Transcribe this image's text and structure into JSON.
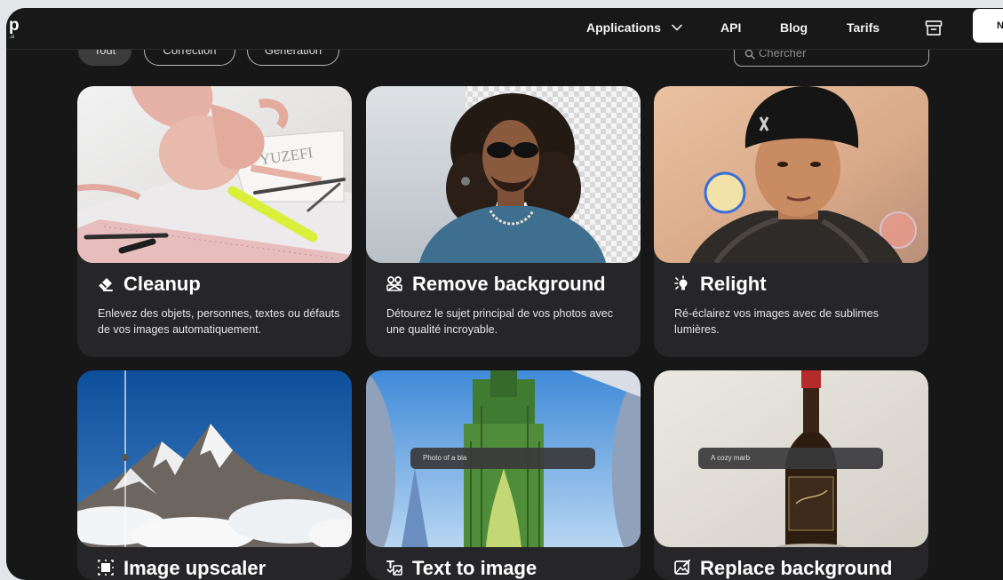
{
  "nav": {
    "logo_mark": "p",
    "logo_sub": ".ai",
    "applications_label": "Applications",
    "api_label": "API",
    "blog_label": "Blog",
    "tarifs_label": "Tarifs",
    "cta_label": "N"
  },
  "filters": {
    "all_label": "Tout",
    "correction_label": "Correction",
    "generation_label": "Génération"
  },
  "search": {
    "placeholder": "Chercher"
  },
  "cards": [
    {
      "title": "Cleanup",
      "icon": "eraser-icon",
      "description": "Enlevez des objets, personnes, textes ou défauts de vos images automatiquement."
    },
    {
      "title": "Remove background",
      "icon": "remove-background-icon",
      "description": "Détourez le sujet principal de vos photos avec une qualité incroyable."
    },
    {
      "title": "Relight",
      "icon": "relight-bulb-icon",
      "description": "Ré-éclairez vos images avec de sublimes lumières."
    },
    {
      "title": "Image upscaler",
      "icon": "upscale-icon",
      "description": ""
    },
    {
      "title": "Text to image",
      "icon": "text-to-image-icon",
      "description": "",
      "prompt": "Photo of a bla"
    },
    {
      "title": "Replace background",
      "icon": "replace-background-icon",
      "description": "",
      "prompt": "A cozy marb"
    }
  ],
  "thumbnail_artwork": {
    "cleanup": {
      "notebook_text": "YUZEFI"
    }
  },
  "colors": {
    "page_background": "#171717",
    "card_background": "#262628",
    "accent_white": "#ffffff"
  }
}
